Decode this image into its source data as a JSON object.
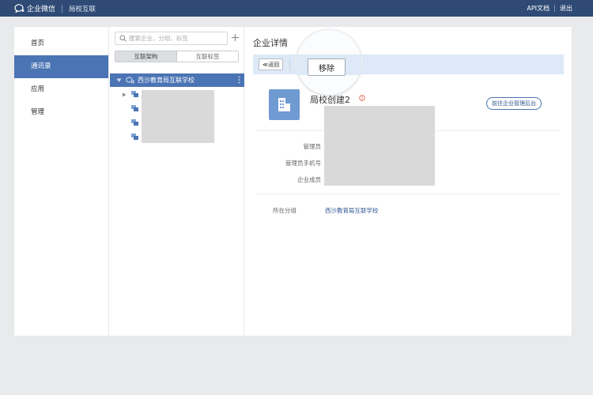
{
  "topbar": {
    "brand": "企业微信",
    "product": "局校互联",
    "links": {
      "api_docs": "API文档",
      "logout": "退出"
    }
  },
  "nav": {
    "items": [
      {
        "label": "首页",
        "active": false
      },
      {
        "label": "通讯录",
        "active": true
      },
      {
        "label": "应用",
        "active": false
      },
      {
        "label": "管理",
        "active": false
      }
    ]
  },
  "tree": {
    "search_placeholder": "搜索企业、分组、标签",
    "tabs": [
      {
        "label": "互联架构",
        "active": true
      },
      {
        "label": "互联标签",
        "active": false
      }
    ],
    "root": {
      "label": "西沙教育局互联学校",
      "expanded": true
    }
  },
  "detail": {
    "title": "企业详情",
    "back_label": "≪返回",
    "remove_label": "移除",
    "org_name": "局校创建2",
    "go_admin_label": "前往企业管理后台",
    "fields": {
      "admin_label": "管理员",
      "admin_phone_label": "管理员手机号",
      "members_label": "企业成员",
      "group_label": "所在分组",
      "group_value": "西沙教育局互联学校"
    }
  },
  "colors": {
    "topbar": "#2e4a75",
    "accent": "#4b74b4",
    "action_bar": "#dde9f6",
    "link": "#2f5591",
    "logo": "#6f9ad2"
  }
}
